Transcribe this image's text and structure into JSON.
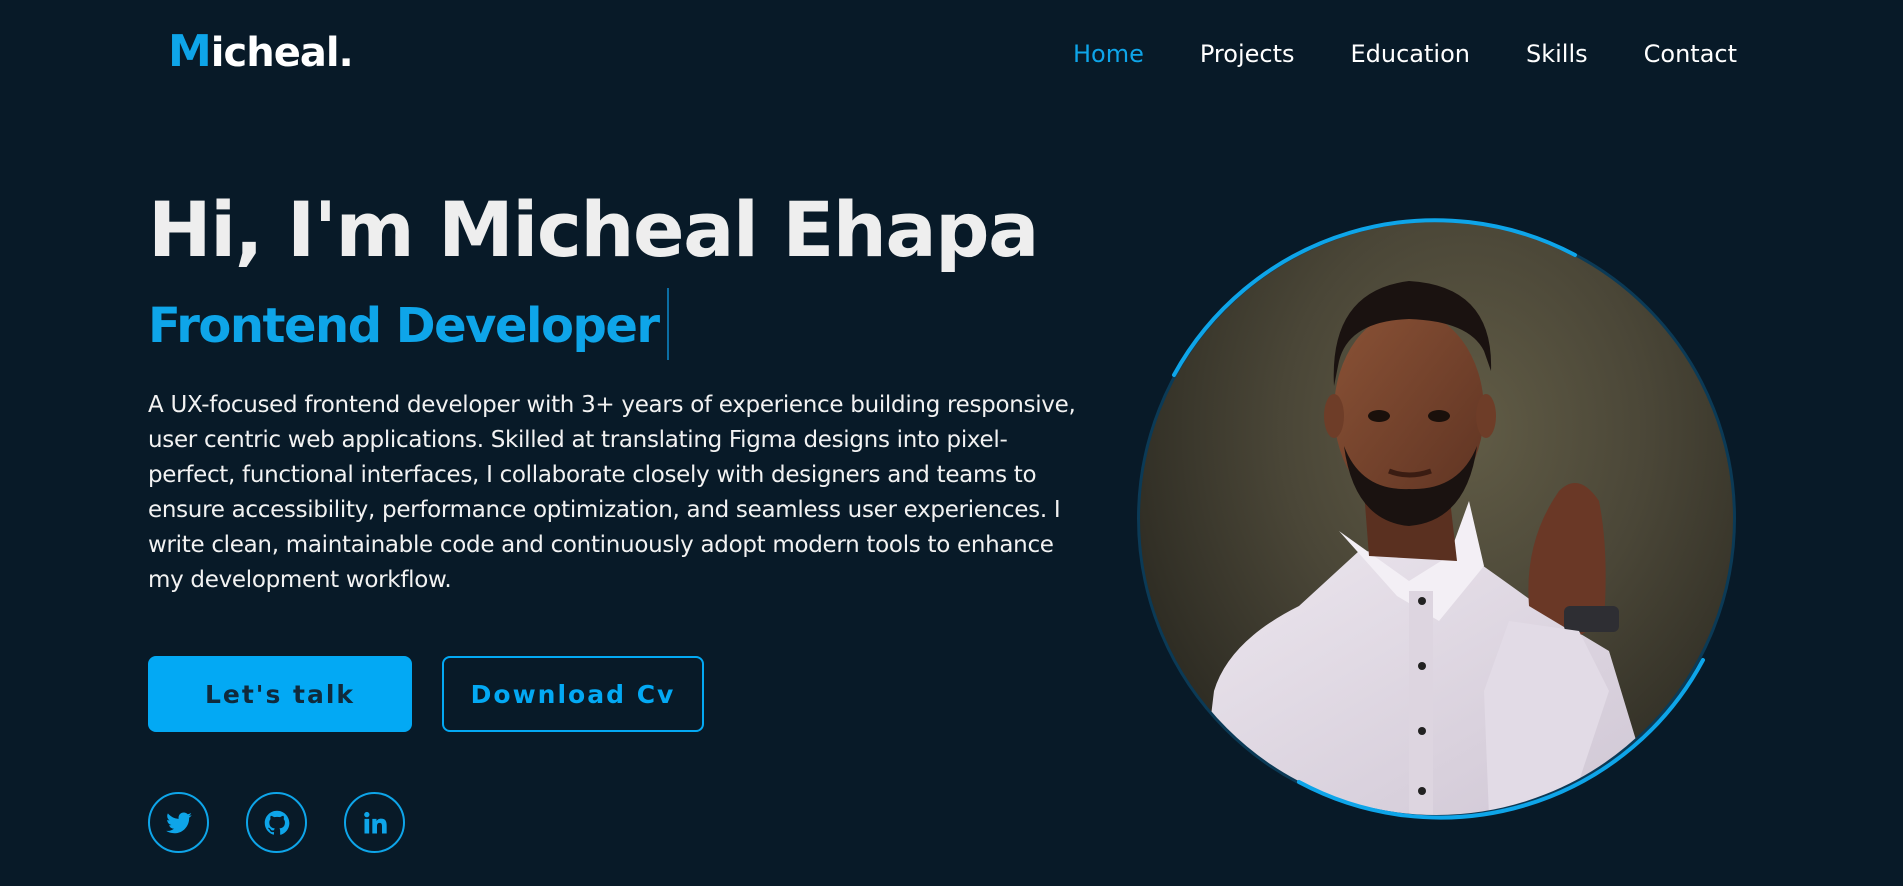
{
  "logo": {
    "initial": "M",
    "rest": "icheal."
  },
  "nav": {
    "items": [
      {
        "label": "Home",
        "active": true
      },
      {
        "label": "Projects",
        "active": false
      },
      {
        "label": "Education",
        "active": false
      },
      {
        "label": "Skills",
        "active": false
      },
      {
        "label": "Contact",
        "active": false
      }
    ]
  },
  "hero": {
    "title": "Hi, I'm Micheal Ehapa",
    "role": "Frontend Developer",
    "description": "A UX-focused frontend developer with 3+ years of experience building responsive, user centric web applications. Skilled at translating Figma designs into pixel-perfect, functional interfaces, I collaborate closely with designers and teams to ensure accessibility, performance optimization, and seamless user experiences. I write clean, maintainable code and continuously adopt modern tools to enhance my development workflow.",
    "primary_button": "Let's talk",
    "secondary_button": "Download Cv"
  },
  "socials": [
    {
      "icon": "twitter-icon"
    },
    {
      "icon": "github-icon"
    },
    {
      "icon": "linkedin-icon"
    }
  ],
  "colors": {
    "background": "#081a28",
    "accent": "#0ea5e9",
    "button": "#03a9f4",
    "text": "#ffffff"
  }
}
